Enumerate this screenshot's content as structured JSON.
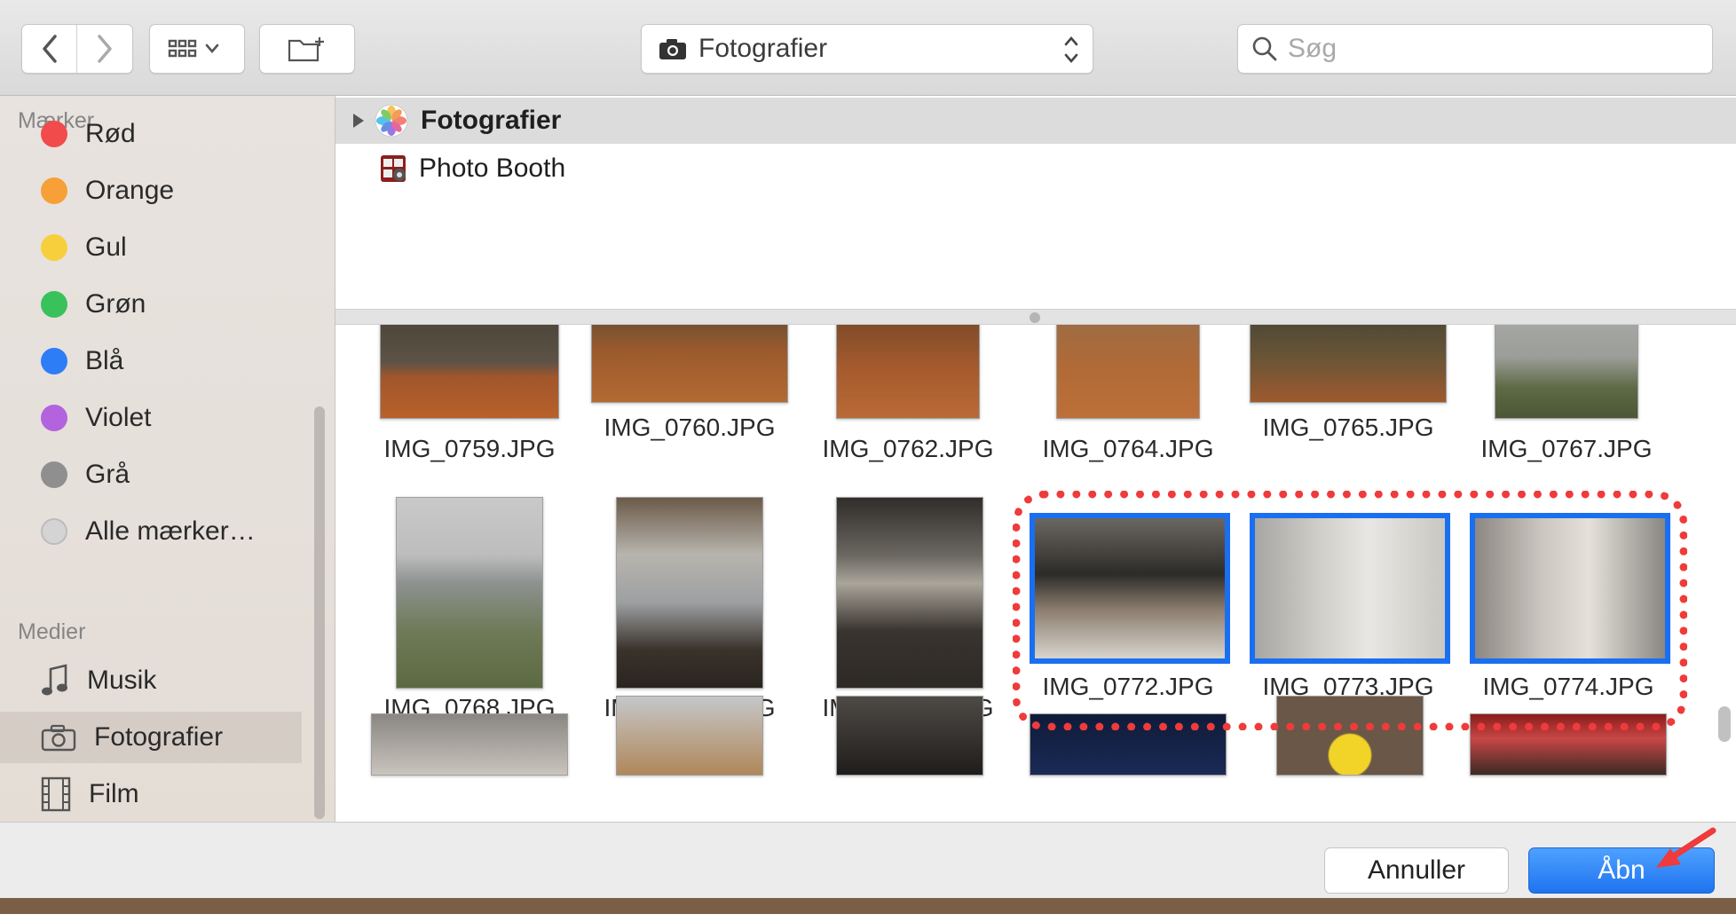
{
  "toolbar": {
    "location_label": "Fotografier",
    "search_placeholder": "Søg"
  },
  "sidebar": {
    "tags_header": "Mærker",
    "tags": [
      {
        "label": "Rød",
        "color": "#f24b4b"
      },
      {
        "label": "Orange",
        "color": "#f6a037"
      },
      {
        "label": "Gul",
        "color": "#f7cf3c"
      },
      {
        "label": "Grøn",
        "color": "#39c15c"
      },
      {
        "label": "Blå",
        "color": "#2c7df6"
      },
      {
        "label": "Violet",
        "color": "#b363dd"
      },
      {
        "label": "Grå",
        "color": "#8f8f8f"
      },
      {
        "label": "Alle mærker…",
        "color": "#d4d4d4"
      }
    ],
    "media_header": "Medier",
    "media": [
      {
        "label": "Musik",
        "icon": "music-note-icon"
      },
      {
        "label": "Fotografier",
        "icon": "camera-icon",
        "selected": true
      },
      {
        "label": "Film",
        "icon": "film-icon"
      }
    ]
  },
  "sources": [
    {
      "label": "Fotografier",
      "icon": "photos-app-icon",
      "selected": true
    },
    {
      "label": "Photo Booth",
      "icon": "photo-booth-icon",
      "selected": false
    }
  ],
  "grid": {
    "row1": [
      "IMG_0759.JPG",
      "IMG_0760.JPG",
      "IMG_0762.JPG",
      "IMG_0764.JPG",
      "IMG_0765.JPG",
      "IMG_0767.JPG"
    ],
    "row2": [
      "IMG_0768.JPG",
      "IMG_0770.JPG",
      "IMG_0771.JPG",
      "IMG_0772.JPG",
      "IMG_0773.JPG",
      "IMG_0774.JPG"
    ],
    "selected": [
      "IMG_0772.JPG",
      "IMG_0773.JPG",
      "IMG_0774.JPG"
    ]
  },
  "buttons": {
    "cancel": "Annuller",
    "open": "Åbn"
  },
  "colors": {
    "accent": "#1a6ff0",
    "annotation": "#ef3b3b"
  }
}
